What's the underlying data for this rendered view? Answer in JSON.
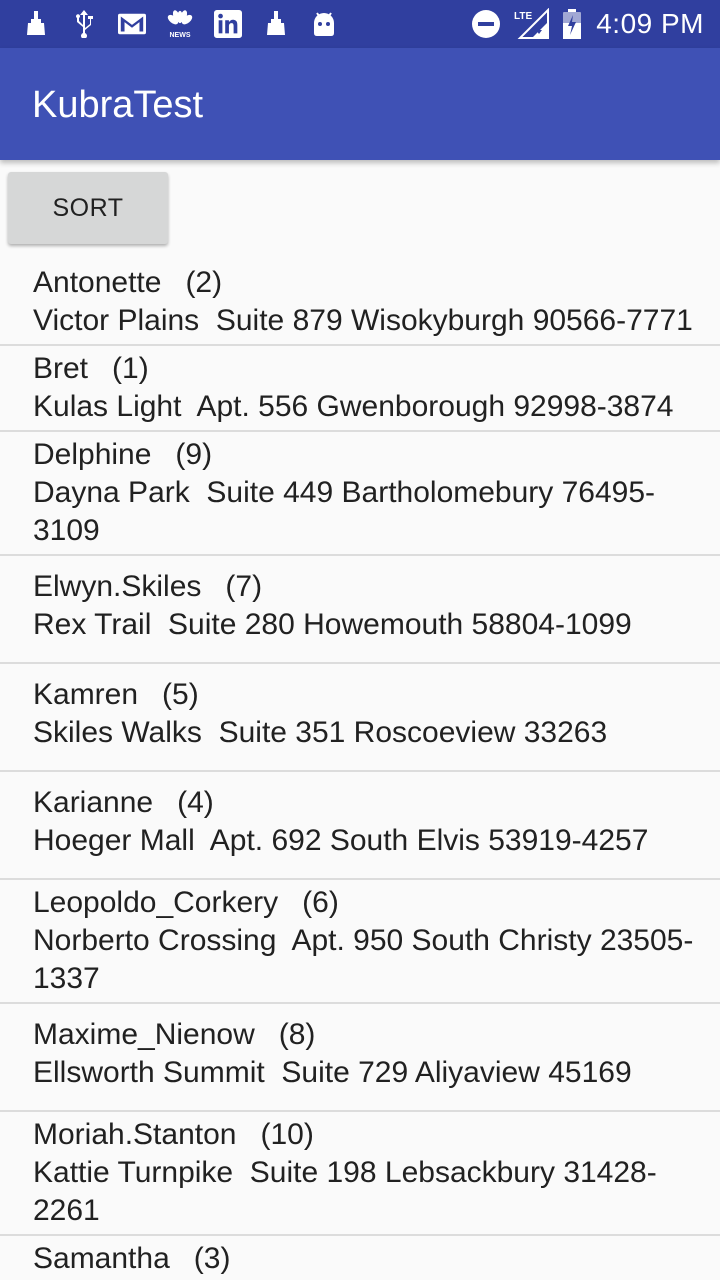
{
  "status_bar": {
    "time": "4:09 PM",
    "left_icons": [
      "cleaner-icon",
      "usb-icon",
      "gmail-icon",
      "nbc-news-icon",
      "linkedin-icon",
      "cleaner-icon",
      "android-icon"
    ],
    "right_icons": [
      "do-not-disturb-icon",
      "lte-signal-icon",
      "battery-icon"
    ],
    "colors": {
      "background": "#303f9f",
      "foreground": "#ffffff"
    }
  },
  "app_bar": {
    "title": "KubraTest",
    "color": "#3f51b5"
  },
  "sort_button": {
    "label": "SORT"
  },
  "users": [
    {
      "name": "Antonette",
      "id": "(2)",
      "address": "Victor Plains  Suite 879 Wisokyburgh 90566-7771"
    },
    {
      "name": "Bret",
      "id": "(1)",
      "address": "Kulas Light  Apt. 556 Gwenborough 92998-3874"
    },
    {
      "name": "Delphine",
      "id": "(9)",
      "address": "Dayna Park  Suite 449 Bartholomebury 76495-3109"
    },
    {
      "name": "Elwyn.Skiles",
      "id": "(7)",
      "address": "Rex Trail  Suite 280 Howemouth 58804-1099"
    },
    {
      "name": "Kamren",
      "id": "(5)",
      "address": "Skiles Walks  Suite 351 Roscoeview 33263"
    },
    {
      "name": "Karianne",
      "id": "(4)",
      "address": "Hoeger Mall  Apt. 692 South Elvis 53919-4257"
    },
    {
      "name": "Leopoldo_Corkery",
      "id": "(6)",
      "address": "Norberto Crossing  Apt. 950 South Christy 23505-1337"
    },
    {
      "name": "Maxime_Nienow",
      "id": "(8)",
      "address": "Ellsworth Summit  Suite 729 Aliyaview 45169"
    },
    {
      "name": "Moriah.Stanton",
      "id": "(10)",
      "address": "Kattie Turnpike  Suite 198 Lebsackbury 31428-2261"
    },
    {
      "name": "Samantha",
      "id": "(3)",
      "address": ""
    }
  ]
}
